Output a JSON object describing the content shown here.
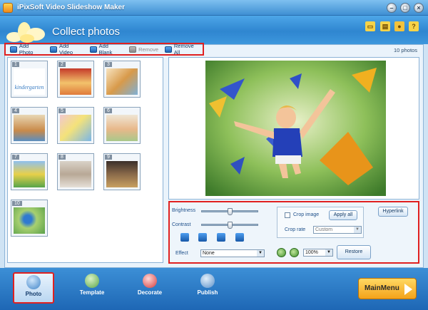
{
  "window": {
    "title": "iPixSoft Video Slideshow Maker"
  },
  "header": {
    "title": "Collect photos"
  },
  "toolbar": {
    "add_photo": "Add Photo",
    "add_video": "Add Video",
    "add_blank": "Add Blank",
    "remove": "Remove",
    "remove_all": "Remove All",
    "count": "10 photos"
  },
  "thumbnails": [
    {
      "num": "1",
      "caption": "kindergarten"
    },
    {
      "num": "2"
    },
    {
      "num": "3"
    },
    {
      "num": "4"
    },
    {
      "num": "5"
    },
    {
      "num": "6"
    },
    {
      "num": "7"
    },
    {
      "num": "8"
    },
    {
      "num": "9"
    },
    {
      "num": "10"
    }
  ],
  "controls": {
    "brightness_label": "Brightness",
    "brightness_level": 0.5,
    "contrast_label": "Contrast",
    "contrast_level": 0.5,
    "effect_label": "Effect",
    "effect_value": "None",
    "crop_label": "Crop image",
    "crop_checked": false,
    "apply_all": "Apply all",
    "crop_rate_label": "Crop rate",
    "crop_rate_value": "Custom",
    "zoom_value": "100%",
    "restore": "Restore",
    "hyperlink": "Hyperlink"
  },
  "bottom_tabs": {
    "photo": "Photo",
    "template": "Template",
    "decorate": "Decorate",
    "publish": "Publish",
    "active": "photo"
  },
  "main_menu": "MainMenu",
  "colors": {
    "accent": "#2f86d0",
    "highlight": "#e02020",
    "menu": "#f3a21a"
  }
}
